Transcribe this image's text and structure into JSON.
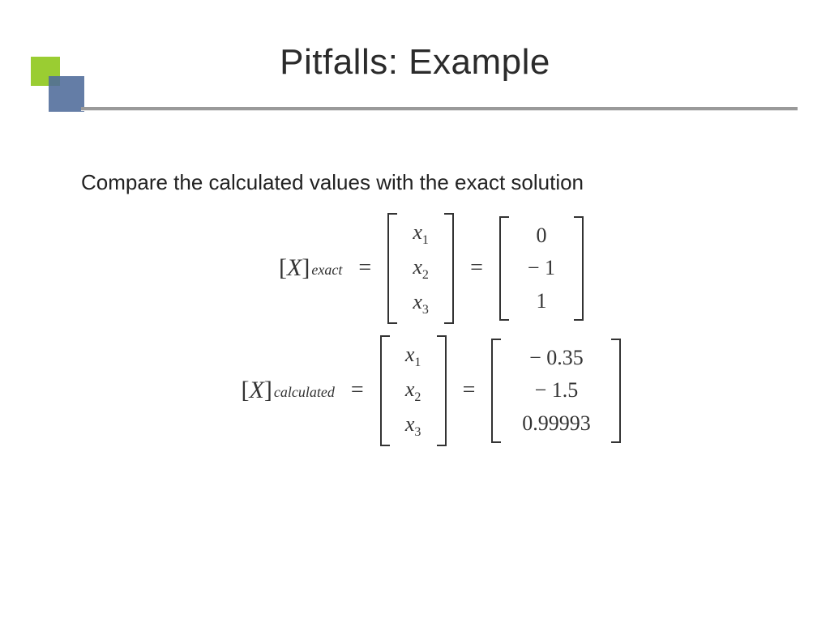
{
  "title": "Pitfalls: Example",
  "lead": "Compare the calculated values with the exact solution",
  "eq": {
    "symbol": "X",
    "var": "x",
    "idx": [
      "1",
      "2",
      "3"
    ],
    "exact": {
      "label": "exact",
      "values": [
        "0",
        "− 1",
        "1"
      ]
    },
    "calculated": {
      "label": "calculated",
      "values": [
        "− 0.35",
        "− 1.5",
        "0.99993"
      ]
    }
  }
}
